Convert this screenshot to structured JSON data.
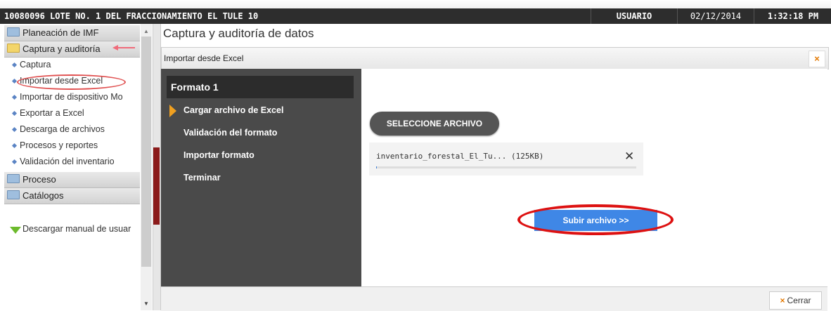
{
  "topbar": {
    "title": "10080096 LOTE NO. 1 DEL FRACCIONAMIENTO EL TULE 10",
    "user": "USUARIO",
    "date": "02/12/2014",
    "time": "1:32:18 PM"
  },
  "sidebar": {
    "sections": [
      {
        "label": "Planeación de IMF"
      },
      {
        "label": "Captura y auditoría"
      },
      {
        "label": "Proceso"
      },
      {
        "label": "Catálogos"
      }
    ],
    "items": [
      {
        "label": "Captura"
      },
      {
        "label": "Importar desde Excel"
      },
      {
        "label": "Importar de dispositivo Mo"
      },
      {
        "label": "Exportar a Excel"
      },
      {
        "label": "Descarga de archivos"
      },
      {
        "label": "Procesos y reportes"
      },
      {
        "label": "Validación del inventario"
      }
    ],
    "download_label": "Descargar manual de usuar"
  },
  "main": {
    "page_title": "Captura y auditoría de datos",
    "panel_title": "Importar desde Excel",
    "wizard": {
      "heading": "Formato 1",
      "steps": [
        {
          "label": "Cargar archivo de Excel"
        },
        {
          "label": "Validación del formato"
        },
        {
          "label": "Importar formato"
        },
        {
          "label": "Terminar"
        }
      ]
    },
    "select_button": "SELECCIONE ARCHIVO",
    "file": {
      "name": "inventario_forestal_El_Tu... (125KB)",
      "progress": 0.0
    },
    "upload_button": "Subir archivo >>",
    "close_label": "Cerrar",
    "close_x": "×"
  },
  "colors": {
    "accent_orange": "#f0a020",
    "upload_blue": "#3f87e6",
    "highlight_red": "#dd1111"
  }
}
